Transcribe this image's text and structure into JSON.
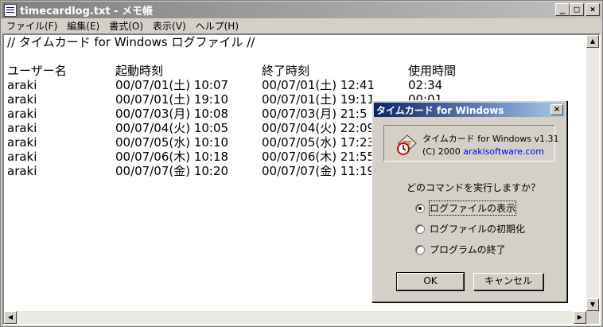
{
  "notepad": {
    "title": "timecardlog.txt - メモ帳",
    "menu": [
      "ファイル(F)",
      "編集(E)",
      "書式(O)",
      "表示(V)",
      "ヘルプ(H)"
    ],
    "content": {
      "header_comment": "// タイムカード for Windows ログファイル //",
      "columns": [
        "ユーザー名",
        "起動時刻",
        "終了時刻",
        "使用時間"
      ],
      "rows": [
        {
          "user": "araki",
          "start": "00/07/01(土) 10:07",
          "end": "00/07/01(土) 12:41",
          "duration": "02:34"
        },
        {
          "user": "araki",
          "start": "00/07/01(土) 19:10",
          "end": "00/07/01(土) 19:11",
          "duration": "00:01"
        },
        {
          "user": "araki",
          "start": "00/07/03(月) 10:08",
          "end": "00/07/03(月) 21:5",
          "duration": ""
        },
        {
          "user": "araki",
          "start": "00/07/04(火) 10:05",
          "end": "00/07/04(火) 22:09",
          "duration": ""
        },
        {
          "user": "araki",
          "start": "00/07/05(水) 10:10",
          "end": "00/07/05(水) 17:23",
          "duration": ""
        },
        {
          "user": "araki",
          "start": "00/07/06(木) 10:18",
          "end": "00/07/06(木) 21:55",
          "duration": ""
        },
        {
          "user": "araki",
          "start": "00/07/07(金) 10:20",
          "end": "00/07/07(金) 11:19",
          "duration": ""
        }
      ]
    }
  },
  "dialog": {
    "title": "タイムカード for Windows",
    "app_name": "タイムカード for Windows v1.31",
    "copyright": "(C) 2000",
    "company": "arakisoftware.com",
    "question": "どのコマンドを実行しますか？",
    "options": [
      {
        "label": "ログファイルの表示",
        "checked": true
      },
      {
        "label": "ログファイルの初期化",
        "checked": false
      },
      {
        "label": "プログラムの終了",
        "checked": false
      }
    ],
    "ok_label": "OK",
    "cancel_label": "キャンセル"
  }
}
